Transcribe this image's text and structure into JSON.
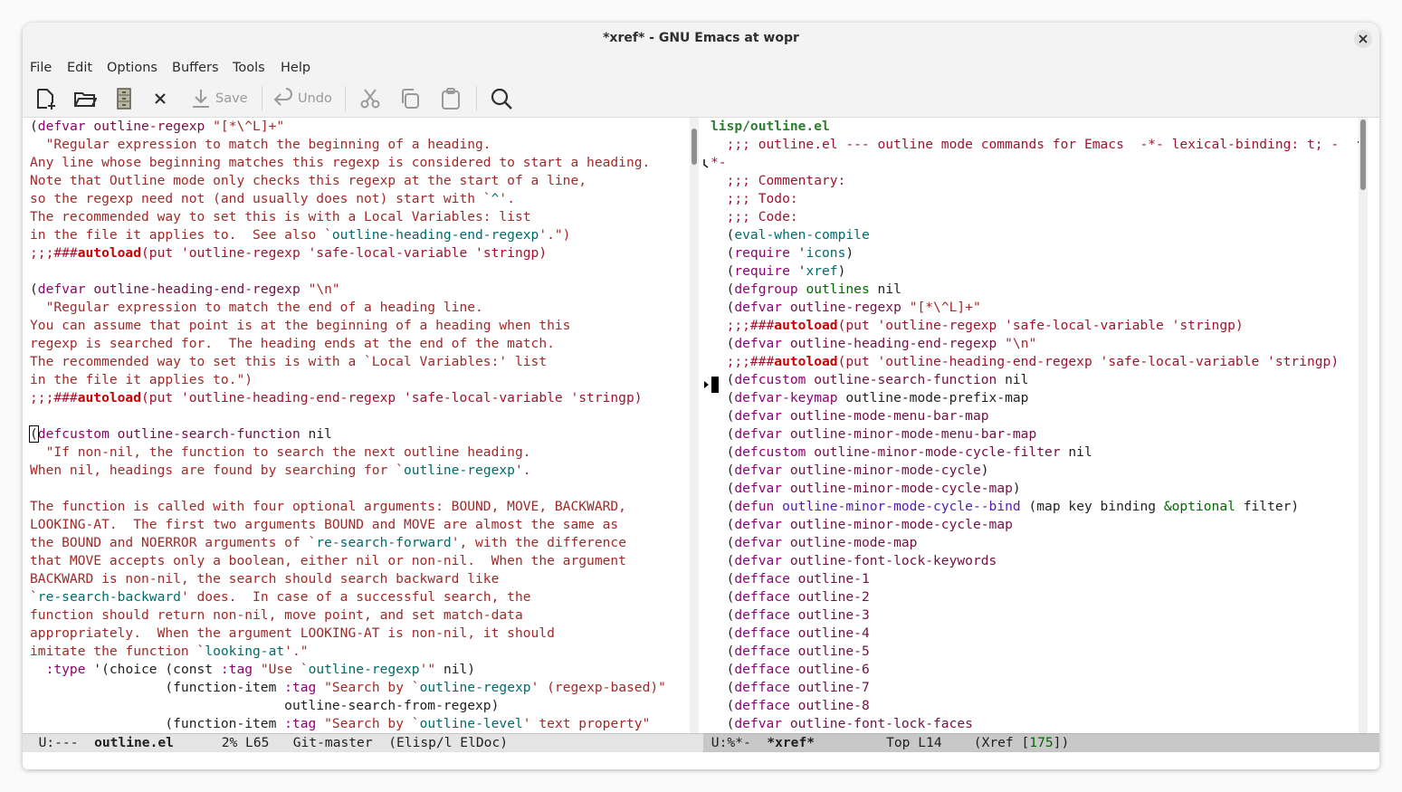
{
  "window": {
    "title": "*xref* - GNU Emacs at wopr"
  },
  "menu": [
    "File",
    "Edit",
    "Options",
    "Buffers",
    "Tools",
    "Help"
  ],
  "toolbar": {
    "save_label": "Save",
    "undo_label": "Undo"
  },
  "left_pane": {
    "lines": [
      [
        [
          "(",
          ""
        ],
        [
          "defvar",
          "v"
        ],
        [
          " ",
          ""
        ],
        [
          "outline-regexp",
          "d"
        ],
        [
          " ",
          ""
        ],
        [
          "\"[*\\^L]+\"",
          "s"
        ]
      ],
      [
        [
          "  \"Regular expression to match the beginning of a heading.",
          "s"
        ]
      ],
      [
        [
          "Any line whose beginning matches this regexp is considered to start a heading.",
          "s"
        ]
      ],
      [
        [
          "Note that Outline mode only checks this regexp at the start of a line,",
          "s"
        ]
      ],
      [
        [
          "so the regexp need not (and usually does not) start with `",
          "s"
        ],
        [
          "^",
          "l"
        ],
        [
          "'.",
          "s"
        ]
      ],
      [
        [
          "The recommended way to set this is with a Local Variables: list",
          "s"
        ]
      ],
      [
        [
          "in the file it applies to.  See also `",
          "s"
        ],
        [
          "outline-heading-end-regexp",
          "l"
        ],
        [
          "'.\")",
          "s"
        ]
      ],
      [
        [
          ";;;###",
          "c"
        ],
        [
          "autoload",
          "bold"
        ],
        [
          "(put 'outline-regexp 'safe-local-variable 'stringp)",
          "c"
        ]
      ],
      [],
      [
        [
          "(",
          ""
        ],
        [
          "defvar",
          "v"
        ],
        [
          " ",
          ""
        ],
        [
          "outline-heading-end-regexp",
          "d"
        ],
        [
          " ",
          ""
        ],
        [
          "\"\\n\"",
          "s"
        ]
      ],
      [
        [
          "  \"Regular expression to match the end of a heading line.",
          "s"
        ]
      ],
      [
        [
          "You can assume that point is at the beginning of a heading when this",
          "s"
        ]
      ],
      [
        [
          "regexp is searched for.  The heading ends at the end of the match.",
          "s"
        ]
      ],
      [
        [
          "The recommended way to set this is with a `Local Variables:' list",
          "s"
        ]
      ],
      [
        [
          "in the file it applies to.\")",
          "s"
        ]
      ],
      [
        [
          ";;;###",
          "c"
        ],
        [
          "autoload",
          "bold"
        ],
        [
          "(put 'outline-heading-end-regexp 'safe-local-variable 'stringp)",
          "c"
        ]
      ],
      [],
      [
        [
          "(",
          "cr"
        ],
        [
          "defcustom",
          "v"
        ],
        [
          " ",
          ""
        ],
        [
          "outline-search-function",
          "d"
        ],
        [
          " nil",
          ""
        ]
      ],
      [
        [
          "  \"If non-nil, the function to search the next outline heading.",
          "s"
        ]
      ],
      [
        [
          "When nil, headings are found by searching for `",
          "s"
        ],
        [
          "outline-regexp",
          "l"
        ],
        [
          "'.",
          "s"
        ]
      ],
      [],
      [
        [
          "The function is called with four optional arguments: BOUND, MOVE, BACKWARD,",
          "s"
        ]
      ],
      [
        [
          "LOOKING-AT.  The first two arguments BOUND and MOVE are almost the same as",
          "s"
        ]
      ],
      [
        [
          "the BOUND and NOERROR arguments of `",
          "s"
        ],
        [
          "re-search-forward",
          "l"
        ],
        [
          "', with the difference",
          "s"
        ]
      ],
      [
        [
          "that MOVE accepts only a boolean, either nil or non-nil.  When the argument",
          "s"
        ]
      ],
      [
        [
          "BACKWARD is non-nil, the search should search backward like",
          "s"
        ]
      ],
      [
        [
          "`",
          "s"
        ],
        [
          "re-search-backward",
          "l"
        ],
        [
          "' does.  In case of a successful search, the",
          "s"
        ]
      ],
      [
        [
          "function should return non-nil, move point, and set match-data",
          "s"
        ]
      ],
      [
        [
          "appropriately.  When the argument LOOKING-AT is non-nil, it should",
          "s"
        ]
      ],
      [
        [
          "imitate the function `",
          "s"
        ],
        [
          "looking-at",
          "l"
        ],
        [
          "'.\"",
          "s"
        ]
      ],
      [
        [
          "  ",
          ""
        ],
        [
          ":type",
          "kw"
        ],
        [
          " '(choice (const ",
          ""
        ],
        [
          ":tag",
          "kw"
        ],
        [
          " ",
          ""
        ],
        [
          "\"Use `",
          "s"
        ],
        [
          "outline-regexp",
          "l"
        ],
        [
          "'\"",
          "s"
        ],
        [
          " nil)",
          ""
        ]
      ],
      [
        [
          "                 (function-item ",
          ""
        ],
        [
          ":tag",
          "kw"
        ],
        [
          " ",
          ""
        ],
        [
          "\"Search by `",
          "s"
        ],
        [
          "outline-regexp",
          "l"
        ],
        [
          "' (regexp-based)\"",
          "s"
        ]
      ],
      [
        [
          "                                outline-search-from-regexp)",
          ""
        ]
      ],
      [
        [
          "                 (function-item ",
          ""
        ],
        [
          ":tag",
          "kw"
        ],
        [
          " ",
          ""
        ],
        [
          "\"Search by `",
          "s"
        ],
        [
          "outline-level",
          "l"
        ],
        [
          "' text property\"",
          "s"
        ]
      ]
    ]
  },
  "right_pane": {
    "header": "lisp/outline.el",
    "lines": [
      [
        [
          "  ;;; outline.el --- outline mode commands for Emacs  -*- lexical-binding: t; -",
          "c"
        ]
      ],
      [
        [
          "*-",
          "c"
        ]
      ],
      [
        [
          "  ;;; Commentary:",
          "c"
        ]
      ],
      [
        [
          "  ;;; Todo:",
          "c"
        ]
      ],
      [
        [
          "  ;;; Code:",
          "c"
        ]
      ],
      [
        [
          "  (",
          ""
        ],
        [
          "eval-when-compile",
          "l"
        ]
      ],
      [
        [
          "  (",
          ""
        ],
        [
          "require",
          "v"
        ],
        [
          " '",
          ""
        ],
        [
          "icons",
          "l"
        ],
        [
          ")",
          ""
        ]
      ],
      [
        [
          "  (",
          ""
        ],
        [
          "require",
          "v"
        ],
        [
          " '",
          ""
        ],
        [
          "xref",
          "l"
        ],
        [
          ")",
          ""
        ]
      ],
      [
        [
          "  (",
          ""
        ],
        [
          "defgroup",
          "v"
        ],
        [
          " ",
          ""
        ],
        [
          "outlines",
          "bc"
        ],
        [
          " nil",
          ""
        ]
      ],
      [
        [
          "  (",
          ""
        ],
        [
          "defvar",
          "v"
        ],
        [
          " ",
          ""
        ],
        [
          "outline-regexp",
          "d"
        ],
        [
          " ",
          ""
        ],
        [
          "\"[*\\^L]+\"",
          "s"
        ]
      ],
      [
        [
          "  ;;;###",
          "c"
        ],
        [
          "autoload",
          "bold"
        ],
        [
          "(put 'outline-regexp 'safe-local-variable 'stringp)",
          "c"
        ]
      ],
      [
        [
          "  (",
          ""
        ],
        [
          "defvar",
          "v"
        ],
        [
          " ",
          ""
        ],
        [
          "outline-heading-end-regexp",
          "d"
        ],
        [
          " ",
          ""
        ],
        [
          "\"\\n\"",
          "s"
        ]
      ],
      [
        [
          "  ;;;###",
          "c"
        ],
        [
          "autoload",
          "bold"
        ],
        [
          "(put 'outline-heading-end-regexp 'safe-local-variable 'stringp)",
          "c"
        ]
      ],
      [
        [
          "  (",
          ""
        ],
        [
          "defcustom",
          "v"
        ],
        [
          " ",
          ""
        ],
        [
          "outline-search-function",
          "d"
        ],
        [
          " nil",
          ""
        ]
      ],
      [
        [
          "  (",
          ""
        ],
        [
          "defvar-keymap",
          "v"
        ],
        [
          " outline-mode-prefix-map",
          ""
        ]
      ],
      [
        [
          "  (",
          ""
        ],
        [
          "defvar",
          "v"
        ],
        [
          " ",
          ""
        ],
        [
          "outline-mode-menu-bar-map",
          "d"
        ]
      ],
      [
        [
          "  (",
          ""
        ],
        [
          "defvar",
          "v"
        ],
        [
          " ",
          ""
        ],
        [
          "outline-minor-mode-menu-bar-map",
          "d"
        ]
      ],
      [
        [
          "  (",
          ""
        ],
        [
          "defcustom",
          "v"
        ],
        [
          " ",
          ""
        ],
        [
          "outline-minor-mode-cycle-filter",
          "d"
        ],
        [
          " nil",
          ""
        ]
      ],
      [
        [
          "  (",
          ""
        ],
        [
          "defvar",
          "v"
        ],
        [
          " ",
          ""
        ],
        [
          "outline-minor-mode-cycle",
          "d"
        ],
        [
          ")",
          ""
        ]
      ],
      [
        [
          "  (",
          ""
        ],
        [
          "defvar",
          "v"
        ],
        [
          " ",
          ""
        ],
        [
          "outline-minor-mode-cycle-map",
          "d"
        ],
        [
          ")",
          ""
        ]
      ],
      [
        [
          "  (",
          ""
        ],
        [
          "defun",
          "v"
        ],
        [
          " ",
          ""
        ],
        [
          "outline-minor-mode-cycle--bind",
          "fn"
        ],
        [
          " (map key binding ",
          ""
        ],
        [
          "&optional",
          "bc"
        ],
        [
          " filter)",
          ""
        ]
      ],
      [
        [
          "  (",
          ""
        ],
        [
          "defvar",
          "v"
        ],
        [
          " ",
          ""
        ],
        [
          "outline-minor-mode-cycle-map",
          "d"
        ]
      ],
      [
        [
          "  (",
          ""
        ],
        [
          "defvar",
          "v"
        ],
        [
          " ",
          ""
        ],
        [
          "outline-mode-map",
          "d"
        ]
      ],
      [
        [
          "  (",
          ""
        ],
        [
          "defvar",
          "v"
        ],
        [
          " ",
          ""
        ],
        [
          "outline-font-lock-keywords",
          "d"
        ]
      ],
      [
        [
          "  (",
          ""
        ],
        [
          "defface",
          "v"
        ],
        [
          " ",
          ""
        ],
        [
          "outline-1",
          "d"
        ]
      ],
      [
        [
          "  (",
          ""
        ],
        [
          "defface",
          "v"
        ],
        [
          " ",
          ""
        ],
        [
          "outline-2",
          "d"
        ]
      ],
      [
        [
          "  (",
          ""
        ],
        [
          "defface",
          "v"
        ],
        [
          " ",
          ""
        ],
        [
          "outline-3",
          "d"
        ]
      ],
      [
        [
          "  (",
          ""
        ],
        [
          "defface",
          "v"
        ],
        [
          " ",
          ""
        ],
        [
          "outline-4",
          "d"
        ]
      ],
      [
        [
          "  (",
          ""
        ],
        [
          "defface",
          "v"
        ],
        [
          " ",
          ""
        ],
        [
          "outline-5",
          "d"
        ]
      ],
      [
        [
          "  (",
          ""
        ],
        [
          "defface",
          "v"
        ],
        [
          " ",
          ""
        ],
        [
          "outline-6",
          "d"
        ]
      ],
      [
        [
          "  (",
          ""
        ],
        [
          "defface",
          "v"
        ],
        [
          " ",
          ""
        ],
        [
          "outline-7",
          "d"
        ]
      ],
      [
        [
          "  (",
          ""
        ],
        [
          "defface",
          "v"
        ],
        [
          " ",
          ""
        ],
        [
          "outline-8",
          "d"
        ]
      ],
      [
        [
          "  (",
          ""
        ],
        [
          "defvar",
          "v"
        ],
        [
          " ",
          ""
        ],
        [
          "outline-font-lock-faces",
          "d"
        ]
      ]
    ]
  },
  "modeline_left": {
    "state": "U:---",
    "buffer": "outline.el",
    "position": "2% L65",
    "vc": "Git-master",
    "modes": "(Elisp/l ElDoc)"
  },
  "modeline_right": {
    "state": "U:%*-",
    "buffer": "*xref*",
    "position": "Top L14",
    "mode_prefix": "(Xref [",
    "count": "175",
    "mode_suffix": "])"
  },
  "colors": {
    "comment": "#a0132f",
    "string": "#a02a2a",
    "definition": "#721045",
    "keyword": "#8f0075",
    "link": "#006b6b",
    "header": "#2e7d32"
  }
}
